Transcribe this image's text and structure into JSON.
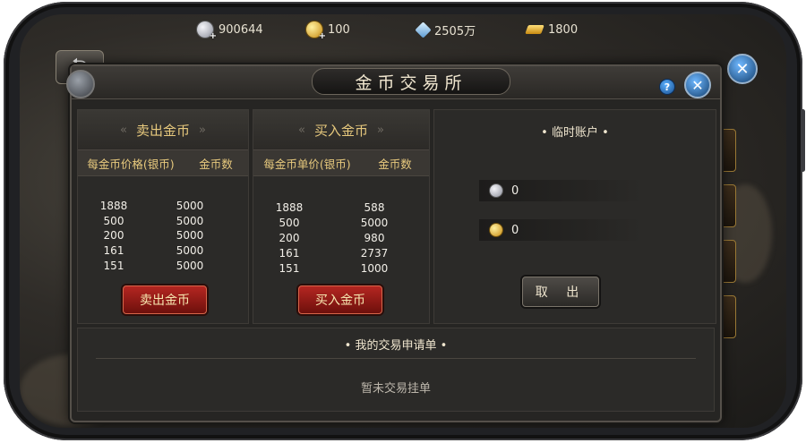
{
  "resources": [
    {
      "icon": "silver-coin-icon",
      "value": "900644"
    },
    {
      "icon": "gold-coin-icon",
      "value": "100"
    },
    {
      "icon": "diamond-icon",
      "value": "2505万"
    },
    {
      "icon": "gold-bar-icon",
      "value": "1800"
    }
  ],
  "window": {
    "title": "金币交易所",
    "help_glyph": "?",
    "close_glyph": "✕"
  },
  "sell": {
    "heading": "卖出金币",
    "col_price": "每金币价格(银币)",
    "col_amount": "金币数",
    "rows": [
      {
        "price": "1888",
        "amount": "5000"
      },
      {
        "price": "500",
        "amount": "5000"
      },
      {
        "price": "200",
        "amount": "5000"
      },
      {
        "price": "161",
        "amount": "5000"
      },
      {
        "price": "151",
        "amount": "5000"
      }
    ],
    "button": "卖出金币"
  },
  "buy": {
    "heading": "买入金币",
    "col_price": "每金币单价(银币)",
    "col_amount": "金币数",
    "rows": [
      {
        "price": "1888",
        "amount": "588"
      },
      {
        "price": "500",
        "amount": "5000"
      },
      {
        "price": "200",
        "amount": "980"
      },
      {
        "price": "161",
        "amount": "2737"
      },
      {
        "price": "151",
        "amount": "1000"
      }
    ],
    "button": "买入金币"
  },
  "account": {
    "title": "临时账户",
    "silver": "0",
    "gold": "0",
    "withdraw": "取 出"
  },
  "orders": {
    "title": "我的交易申请单",
    "empty": "暂未交易挂单"
  },
  "nav": {
    "arrow_left": "«",
    "arrow_right": "»",
    "back_glyph": "⮌"
  }
}
